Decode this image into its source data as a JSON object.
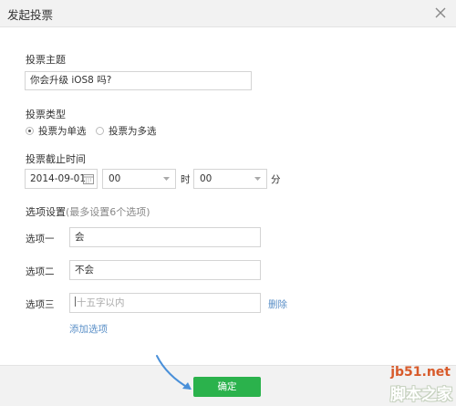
{
  "dialog": {
    "title": "发起投票",
    "close_icon": "close-icon"
  },
  "topic": {
    "label": "投票主题",
    "value": "你会升级 iOS8 吗?"
  },
  "vote_type": {
    "label": "投票类型",
    "options": [
      {
        "label": "投票为单选",
        "checked": true
      },
      {
        "label": "投票为多选",
        "checked": false
      }
    ]
  },
  "deadline": {
    "label": "投票截止时间",
    "date": "2014-09-01",
    "hour": "00",
    "hour_unit": "时",
    "minute": "00",
    "minute_unit": "分"
  },
  "options_settings": {
    "label": "选项设置",
    "hint": "(最多设置6个选项)",
    "items": [
      {
        "label": "选项一",
        "value": "会"
      },
      {
        "label": "选项二",
        "value": "不会"
      },
      {
        "label": "选项三",
        "placeholder": "十五字以内",
        "delete_label": "删除"
      }
    ],
    "add_label": "添加选项"
  },
  "footer": {
    "confirm_label": "确定"
  },
  "watermark": {
    "top": "jb51.net",
    "bottom": "脚本之家"
  },
  "colors": {
    "confirm": "#2bb24c",
    "link": "#5a8fc7",
    "arrow": "#4a90d9"
  }
}
